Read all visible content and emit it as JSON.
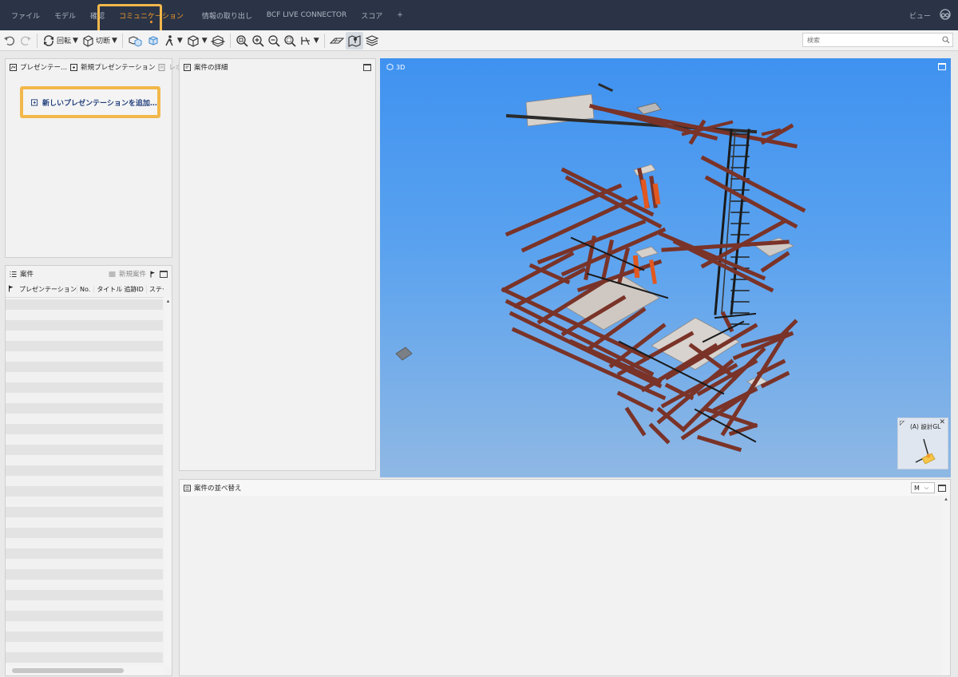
{
  "menubar": {
    "items": [
      "ファイル",
      "モデル",
      "確認",
      "コミュニケーション",
      "情報の取り出し",
      "BCF LIVE CONNECTOR",
      "スコア",
      "+"
    ],
    "active_index": 3,
    "view_label": "ビュー"
  },
  "toolbar": {
    "rotate_label": "回転",
    "section_label": "切断",
    "search_placeholder": "検索"
  },
  "presentations": {
    "tab_label": "プレゼンテー...",
    "new_label": "新規プレゼンテーション",
    "report_label": "レポート",
    "add_button_label": "新しいプレゼンテーションを追加…"
  },
  "issue_details": {
    "title": "案件の詳細"
  },
  "issues": {
    "title": "案件",
    "new_issue_label": "新規案件",
    "columns": [
      "プレゼンテーション",
      "No.",
      "タイトル",
      "追跡ID",
      "ステー"
    ]
  },
  "viewport": {
    "view_label": "3D",
    "navcube_label": "(A) 設計GL",
    "background_top": "#3f92f0",
    "background_bottom": "#8fb8e4",
    "beam_color": "#7a3328",
    "highlight_color": "#e2581f"
  },
  "sort_panel": {
    "title": "案件の並べ替え",
    "select_value": "M"
  },
  "colors": {
    "menubar_bg": "#2b3446",
    "accent": "#f39a2a",
    "highlight_border": "#f2b84b"
  }
}
